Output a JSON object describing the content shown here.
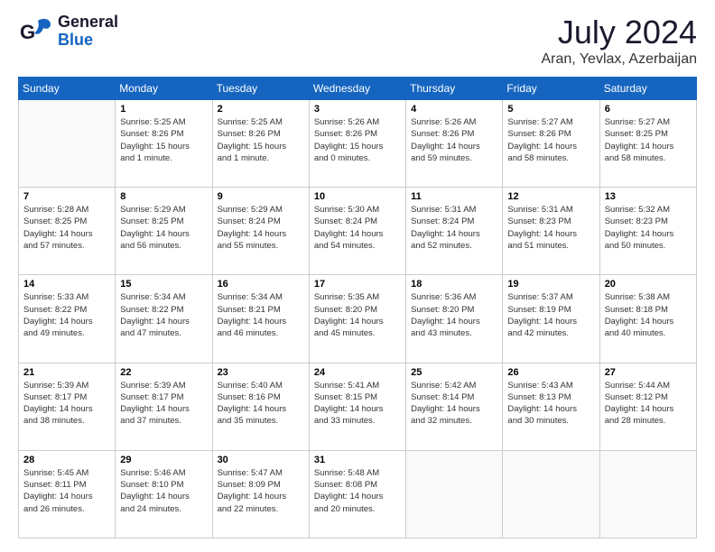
{
  "header": {
    "logo_general": "General",
    "logo_blue": "Blue",
    "title": "July 2024",
    "subtitle": "Aran, Yevlax, Azerbaijan"
  },
  "weekdays": [
    "Sunday",
    "Monday",
    "Tuesday",
    "Wednesday",
    "Thursday",
    "Friday",
    "Saturday"
  ],
  "weeks": [
    [
      {
        "day": "",
        "info": ""
      },
      {
        "day": "1",
        "info": "Sunrise: 5:25 AM\nSunset: 8:26 PM\nDaylight: 15 hours\nand 1 minute."
      },
      {
        "day": "2",
        "info": "Sunrise: 5:25 AM\nSunset: 8:26 PM\nDaylight: 15 hours\nand 1 minute."
      },
      {
        "day": "3",
        "info": "Sunrise: 5:26 AM\nSunset: 8:26 PM\nDaylight: 15 hours\nand 0 minutes."
      },
      {
        "day": "4",
        "info": "Sunrise: 5:26 AM\nSunset: 8:26 PM\nDaylight: 14 hours\nand 59 minutes."
      },
      {
        "day": "5",
        "info": "Sunrise: 5:27 AM\nSunset: 8:26 PM\nDaylight: 14 hours\nand 58 minutes."
      },
      {
        "day": "6",
        "info": "Sunrise: 5:27 AM\nSunset: 8:25 PM\nDaylight: 14 hours\nand 58 minutes."
      }
    ],
    [
      {
        "day": "7",
        "info": "Sunrise: 5:28 AM\nSunset: 8:25 PM\nDaylight: 14 hours\nand 57 minutes."
      },
      {
        "day": "8",
        "info": "Sunrise: 5:29 AM\nSunset: 8:25 PM\nDaylight: 14 hours\nand 56 minutes."
      },
      {
        "day": "9",
        "info": "Sunrise: 5:29 AM\nSunset: 8:24 PM\nDaylight: 14 hours\nand 55 minutes."
      },
      {
        "day": "10",
        "info": "Sunrise: 5:30 AM\nSunset: 8:24 PM\nDaylight: 14 hours\nand 54 minutes."
      },
      {
        "day": "11",
        "info": "Sunrise: 5:31 AM\nSunset: 8:24 PM\nDaylight: 14 hours\nand 52 minutes."
      },
      {
        "day": "12",
        "info": "Sunrise: 5:31 AM\nSunset: 8:23 PM\nDaylight: 14 hours\nand 51 minutes."
      },
      {
        "day": "13",
        "info": "Sunrise: 5:32 AM\nSunset: 8:23 PM\nDaylight: 14 hours\nand 50 minutes."
      }
    ],
    [
      {
        "day": "14",
        "info": "Sunrise: 5:33 AM\nSunset: 8:22 PM\nDaylight: 14 hours\nand 49 minutes."
      },
      {
        "day": "15",
        "info": "Sunrise: 5:34 AM\nSunset: 8:22 PM\nDaylight: 14 hours\nand 47 minutes."
      },
      {
        "day": "16",
        "info": "Sunrise: 5:34 AM\nSunset: 8:21 PM\nDaylight: 14 hours\nand 46 minutes."
      },
      {
        "day": "17",
        "info": "Sunrise: 5:35 AM\nSunset: 8:20 PM\nDaylight: 14 hours\nand 45 minutes."
      },
      {
        "day": "18",
        "info": "Sunrise: 5:36 AM\nSunset: 8:20 PM\nDaylight: 14 hours\nand 43 minutes."
      },
      {
        "day": "19",
        "info": "Sunrise: 5:37 AM\nSunset: 8:19 PM\nDaylight: 14 hours\nand 42 minutes."
      },
      {
        "day": "20",
        "info": "Sunrise: 5:38 AM\nSunset: 8:18 PM\nDaylight: 14 hours\nand 40 minutes."
      }
    ],
    [
      {
        "day": "21",
        "info": "Sunrise: 5:39 AM\nSunset: 8:17 PM\nDaylight: 14 hours\nand 38 minutes."
      },
      {
        "day": "22",
        "info": "Sunrise: 5:39 AM\nSunset: 8:17 PM\nDaylight: 14 hours\nand 37 minutes."
      },
      {
        "day": "23",
        "info": "Sunrise: 5:40 AM\nSunset: 8:16 PM\nDaylight: 14 hours\nand 35 minutes."
      },
      {
        "day": "24",
        "info": "Sunrise: 5:41 AM\nSunset: 8:15 PM\nDaylight: 14 hours\nand 33 minutes."
      },
      {
        "day": "25",
        "info": "Sunrise: 5:42 AM\nSunset: 8:14 PM\nDaylight: 14 hours\nand 32 minutes."
      },
      {
        "day": "26",
        "info": "Sunrise: 5:43 AM\nSunset: 8:13 PM\nDaylight: 14 hours\nand 30 minutes."
      },
      {
        "day": "27",
        "info": "Sunrise: 5:44 AM\nSunset: 8:12 PM\nDaylight: 14 hours\nand 28 minutes."
      }
    ],
    [
      {
        "day": "28",
        "info": "Sunrise: 5:45 AM\nSunset: 8:11 PM\nDaylight: 14 hours\nand 26 minutes."
      },
      {
        "day": "29",
        "info": "Sunrise: 5:46 AM\nSunset: 8:10 PM\nDaylight: 14 hours\nand 24 minutes."
      },
      {
        "day": "30",
        "info": "Sunrise: 5:47 AM\nSunset: 8:09 PM\nDaylight: 14 hours\nand 22 minutes."
      },
      {
        "day": "31",
        "info": "Sunrise: 5:48 AM\nSunset: 8:08 PM\nDaylight: 14 hours\nand 20 minutes."
      },
      {
        "day": "",
        "info": ""
      },
      {
        "day": "",
        "info": ""
      },
      {
        "day": "",
        "info": ""
      }
    ]
  ]
}
